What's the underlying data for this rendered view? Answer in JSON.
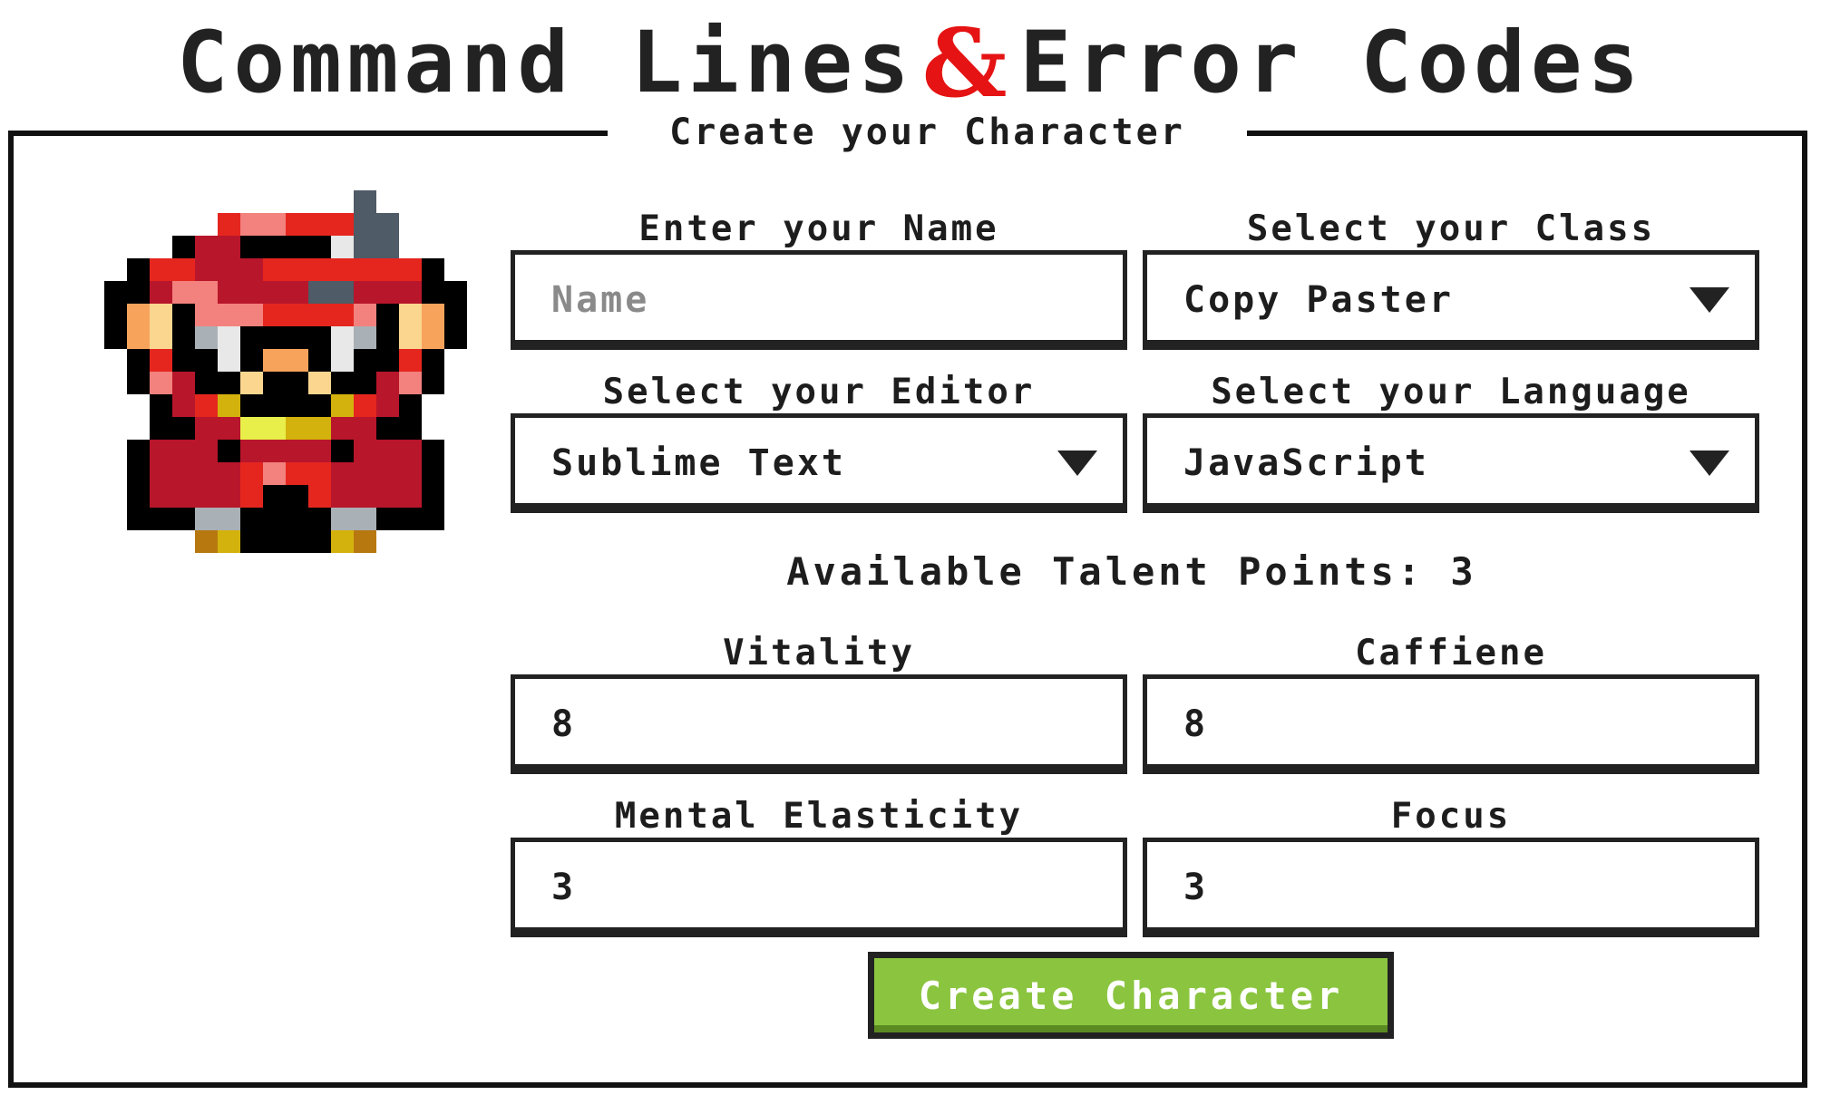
{
  "app": {
    "title_left": "Command Lines",
    "title_amp": "&",
    "title_right": "Error Codes"
  },
  "panel": {
    "legend": "Create your Character"
  },
  "form": {
    "name_label": "Enter your Name",
    "name_placeholder": "Name",
    "name_value": "",
    "class_label": "Select your Class",
    "class_value": "Copy Paster",
    "editor_label": "Select your Editor",
    "editor_value": "Sublime Text",
    "language_label": "Select your Language",
    "language_value": "JavaScript",
    "talent_points": "Available Talent Points: 3",
    "vitality_label": "Vitality",
    "vitality_value": "8",
    "caffeine_label": "Caffiene",
    "caffeine_value": "8",
    "mental_label": "Mental Elasticity",
    "mental_value": "3",
    "focus_label": "Focus",
    "focus_value": "3",
    "submit_label": "Create Character"
  },
  "icons": {
    "dropdown": "chevron-down-icon",
    "avatar": "pixel-warrior-avatar",
    "logo": "dragon-ampersand-logo"
  },
  "colors": {
    "accent_button": "#8bc540",
    "logo_red": "#e51313"
  }
}
